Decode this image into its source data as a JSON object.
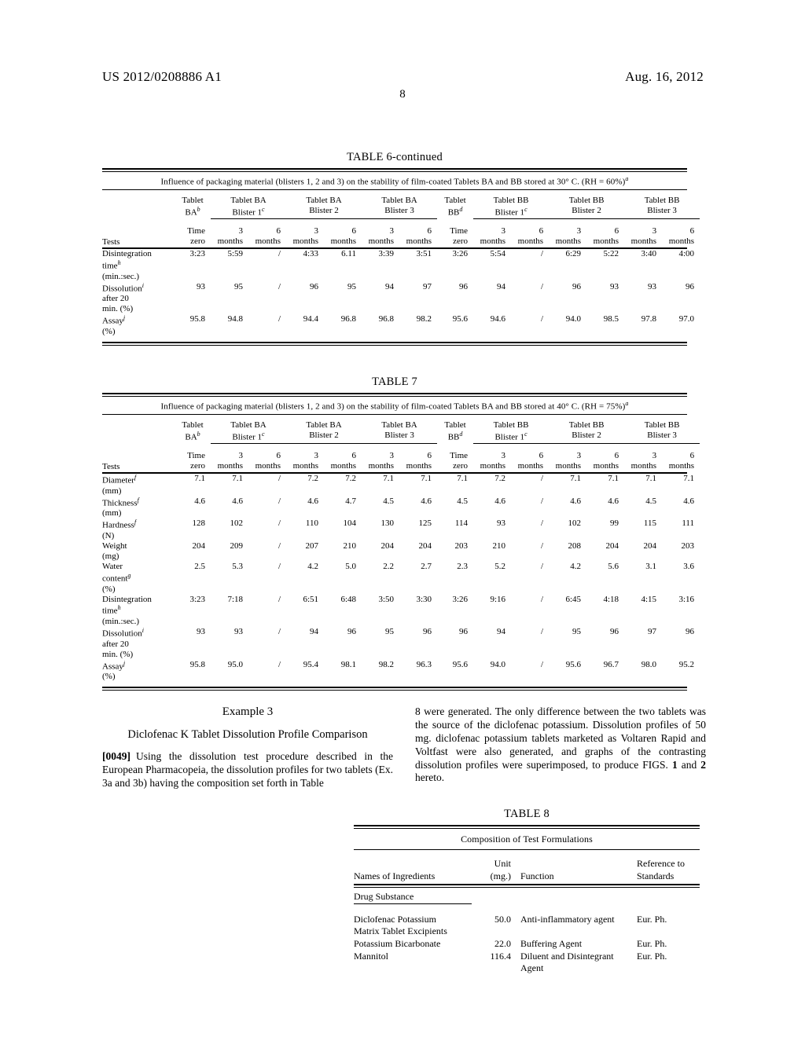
{
  "header": {
    "publication_number": "US 2012/0208886 A1",
    "date": "Aug. 16, 2012",
    "page_number": "8"
  },
  "table6": {
    "caption": "TABLE 6-continued",
    "subtitle": "Influence of packaging material (blisters 1, 2 and 3) on the stability of film-coated Tablets BA and BB stored at 30° C. (RH = 60%)",
    "subtitle_sup": "a",
    "groups": [
      {
        "line1": "Tablet",
        "line2": "BA",
        "sup": "b",
        "span": 1,
        "underline": false
      },
      {
        "line1": "Tablet BA",
        "line2": "Blister 1",
        "sup": "c",
        "span": 2,
        "underline": true
      },
      {
        "line1": "Tablet BA",
        "line2": "Blister 2",
        "sup": "",
        "span": 2,
        "underline": true
      },
      {
        "line1": "Tablet BA",
        "line2": "Blister 3",
        "sup": "",
        "span": 2,
        "underline": true
      },
      {
        "line1": "Tablet",
        "line2": "BB",
        "sup": "d",
        "span": 1,
        "underline": false
      },
      {
        "line1": "Tablet BB",
        "line2": "Blister 1",
        "sup": "c",
        "span": 2,
        "underline": true
      },
      {
        "line1": "Tablet BB",
        "line2": "Blister 2",
        "sup": "",
        "span": 2,
        "underline": true
      },
      {
        "line1": "Tablet BB",
        "line2": "Blister 3",
        "sup": "",
        "span": 2,
        "underline": true
      }
    ],
    "stub_header": "Tests",
    "time_headers": [
      {
        "l1": "Time",
        "l2": "zero"
      },
      {
        "l1": "3",
        "l2": "months"
      },
      {
        "l1": "6",
        "l2": "months"
      },
      {
        "l1": "3",
        "l2": "months"
      },
      {
        "l1": "6",
        "l2": "months"
      },
      {
        "l1": "3",
        "l2": "months"
      },
      {
        "l1": "6",
        "l2": "months"
      },
      {
        "l1": "Time",
        "l2": "zero"
      },
      {
        "l1": "3",
        "l2": "months"
      },
      {
        "l1": "6",
        "l2": "months"
      },
      {
        "l1": "3",
        "l2": "months"
      },
      {
        "l1": "6",
        "l2": "months"
      },
      {
        "l1": "3",
        "l2": "months"
      },
      {
        "l1": "6",
        "l2": "months"
      }
    ],
    "rows": [
      {
        "label": "Disintegration",
        "sup": "h",
        "label_cont": [
          "time",
          "(min.:sec.)"
        ],
        "sup_on_cont": 0,
        "values": [
          "3:23",
          "5:59",
          "/",
          "4:33",
          "6.11",
          "3:39",
          "3:51",
          "3:26",
          "5:54",
          "/",
          "6:29",
          "5:22",
          "3:40",
          "4:00"
        ]
      },
      {
        "label": "Dissolution",
        "sup": "i",
        "label_cont": [
          "after 20",
          "min. (%)"
        ],
        "sup_on_cont": -1,
        "values": [
          "93",
          "95",
          "/",
          "96",
          "95",
          "94",
          "97",
          "96",
          "94",
          "/",
          "96",
          "93",
          "93",
          "96"
        ]
      },
      {
        "label": "Assay",
        "sup": "j",
        "label_cont": [
          "(%)"
        ],
        "sup_on_cont": -1,
        "values": [
          "95.8",
          "94.8",
          "/",
          "94.4",
          "96.8",
          "96.8",
          "98.2",
          "95.6",
          "94.6",
          "/",
          "94.0",
          "98.5",
          "97.8",
          "97.0"
        ]
      }
    ]
  },
  "table7": {
    "caption": "TABLE 7",
    "subtitle": "Influence of packaging material (blisters 1, 2 and 3) on the stability of film-coated Tablets BA and BB stored at 40° C. (RH = 75%)",
    "subtitle_sup": "a",
    "groups": [
      {
        "line1": "Tablet",
        "line2": "BA",
        "sup": "b",
        "span": 1,
        "underline": false
      },
      {
        "line1": "Tablet BA",
        "line2": "Blister 1",
        "sup": "c",
        "span": 2,
        "underline": true
      },
      {
        "line1": "Tablet BA",
        "line2": "Blister 2",
        "sup": "",
        "span": 2,
        "underline": true
      },
      {
        "line1": "Tablet BA",
        "line2": "Blister 3",
        "sup": "",
        "span": 2,
        "underline": true
      },
      {
        "line1": "Tablet",
        "line2": "BB",
        "sup": "d",
        "span": 1,
        "underline": false
      },
      {
        "line1": "Tablet BB",
        "line2": "Blister 1",
        "sup": "c",
        "span": 2,
        "underline": true
      },
      {
        "line1": "Tablet BB",
        "line2": "Blister 2",
        "sup": "",
        "span": 2,
        "underline": true
      },
      {
        "line1": "Tablet BB",
        "line2": "Blister 3",
        "sup": "",
        "span": 2,
        "underline": true
      }
    ],
    "stub_header": "Tests",
    "time_headers": [
      {
        "l1": "Time",
        "l2": "zero"
      },
      {
        "l1": "3",
        "l2": "months"
      },
      {
        "l1": "6",
        "l2": "months"
      },
      {
        "l1": "3",
        "l2": "months"
      },
      {
        "l1": "6",
        "l2": "months"
      },
      {
        "l1": "3",
        "l2": "months"
      },
      {
        "l1": "6",
        "l2": "months"
      },
      {
        "l1": "Time",
        "l2": "zero"
      },
      {
        "l1": "3",
        "l2": "months"
      },
      {
        "l1": "6",
        "l2": "months"
      },
      {
        "l1": "3",
        "l2": "months"
      },
      {
        "l1": "6",
        "l2": "months"
      },
      {
        "l1": "3",
        "l2": "months"
      },
      {
        "l1": "6",
        "l2": "months"
      }
    ],
    "rows": [
      {
        "label": "Diameter",
        "sup": "f",
        "label_cont": [
          "(mm)"
        ],
        "values": [
          "7.1",
          "7.1",
          "/",
          "7.2",
          "7.2",
          "7.1",
          "7.1",
          "7.1",
          "7.2",
          "/",
          "7.1",
          "7.1",
          "7.1",
          "7.1"
        ]
      },
      {
        "label": "Thickness",
        "sup": "f",
        "label_cont": [
          "(mm)"
        ],
        "values": [
          "4.6",
          "4.6",
          "/",
          "4.6",
          "4.7",
          "4.5",
          "4.6",
          "4.5",
          "4.6",
          "/",
          "4.6",
          "4.6",
          "4.5",
          "4.6"
        ]
      },
      {
        "label": "Hardness",
        "sup": "f",
        "label_cont": [
          "(N)"
        ],
        "values": [
          "128",
          "102",
          "/",
          "110",
          "104",
          "130",
          "125",
          "114",
          "93",
          "/",
          "102",
          "99",
          "115",
          "111"
        ]
      },
      {
        "label": "Weight",
        "sup": "",
        "label_cont": [
          "(mg)"
        ],
        "values": [
          "204",
          "209",
          "/",
          "207",
          "210",
          "204",
          "204",
          "203",
          "210",
          "/",
          "208",
          "204",
          "204",
          "203"
        ]
      },
      {
        "label": "Water",
        "sup": "",
        "label_cont": [
          "content",
          "(%)"
        ],
        "cont_sup": "g",
        "cont_sup_index": 0,
        "values": [
          "2.5",
          "5.3",
          "/",
          "4.2",
          "5.0",
          "2.2",
          "2.7",
          "2.3",
          "5.2",
          "/",
          "4.2",
          "5.6",
          "3.1",
          "3.6"
        ]
      },
      {
        "label": "Disintegration",
        "sup": "",
        "label_cont": [
          "time",
          "(min.:sec.)"
        ],
        "cont_sup": "h",
        "cont_sup_index": 0,
        "values": [
          "3:23",
          "7:18",
          "/",
          "6:51",
          "6:48",
          "3:50",
          "3:30",
          "3:26",
          "9:16",
          "/",
          "6:45",
          "4:18",
          "4:15",
          "3:16"
        ]
      },
      {
        "label": "Dissolution",
        "sup": "i",
        "label_cont": [
          "after 20",
          "min. (%)"
        ],
        "values": [
          "93",
          "93",
          "/",
          "94",
          "96",
          "95",
          "96",
          "96",
          "94",
          "/",
          "95",
          "96",
          "97",
          "96"
        ]
      },
      {
        "label": "Assay",
        "sup": "j",
        "label_cont": [
          "(%)"
        ],
        "values": [
          "95.8",
          "95.0",
          "/",
          "95.4",
          "98.1",
          "98.2",
          "96.3",
          "95.6",
          "94.0",
          "/",
          "95.6",
          "96.7",
          "98.0",
          "95.2"
        ]
      }
    ]
  },
  "example": {
    "title": "Example 3",
    "subtitle": "Diclofenac K Tablet Dissolution Profile Comparison",
    "paragraph_number": "[0049]",
    "left_text": "Using the dissolution test procedure described in the European Pharmacopeia, the dissolution profiles for two tablets (Ex. 3a and 3b) having the composition set forth in Table",
    "right_text_part1": "8 were generated. The only difference between the two tablets was the source of the diclofenac potassium. Dissolution profiles of 50 mg. diclofenac potassium tablets marketed as Voltaren Rapid and Voltfast were also generated, and graphs of the contrasting dissolution profiles were superimposed, to produce FIGS. ",
    "right_fig1": "1",
    "right_text_part2": " and ",
    "right_fig2": "2",
    "right_text_part3": " hereto."
  },
  "table8": {
    "caption": "TABLE 8",
    "subtitle": "Composition of Test Formulations",
    "headers": {
      "names": "Names of Ingredients",
      "unit": "Unit (mg.)",
      "function": "Function",
      "reference_l1": "Reference to",
      "reference_l2": "Standards"
    },
    "section1": "Drug Substance",
    "rows": [
      {
        "name": "Diclofenac Potassium",
        "unit": "50.0",
        "function": "Anti-inflammatory agent",
        "function_cont": "",
        "reference": "Eur. Ph."
      },
      {
        "name": "Matrix Tablet Excipients",
        "unit": "",
        "function": "",
        "function_cont": "",
        "reference": ""
      },
      {
        "name": "Potassium Bicarbonate",
        "unit": "22.0",
        "function": "Buffering Agent",
        "function_cont": "",
        "reference": "Eur. Ph."
      },
      {
        "name": "Mannitol",
        "unit": "116.4",
        "function": "Diluent and Disintegrant",
        "function_cont": "Agent",
        "reference": "Eur. Ph."
      }
    ]
  }
}
